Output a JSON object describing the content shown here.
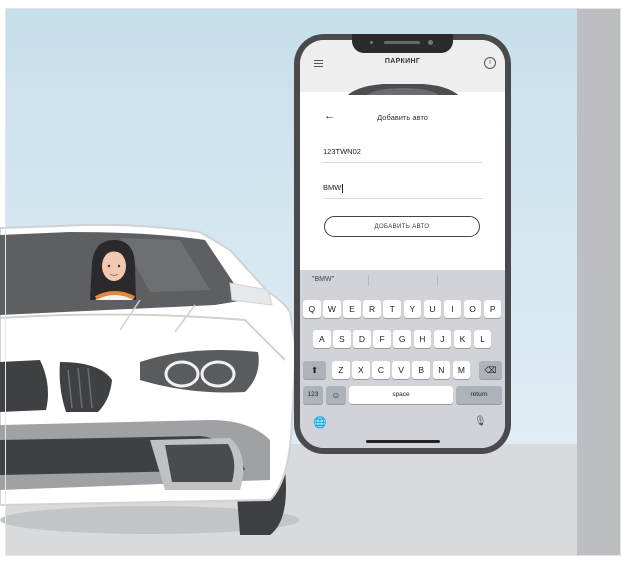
{
  "app": {
    "title": "ПАРКИНГ",
    "menu_icon": "hamburger-menu-icon",
    "info_icon": "info-icon",
    "info_glyph": "i"
  },
  "sheet": {
    "back_glyph": "←",
    "title": "Добавить авто",
    "plate_value": "123TWN02",
    "brand_value": "BMW",
    "add_button_label": "ДОБАВИТЬ АВТО"
  },
  "keyboard": {
    "suggestion": "\"BMW\"",
    "row1": [
      "Q",
      "W",
      "E",
      "R",
      "T",
      "Y",
      "U",
      "I",
      "O",
      "P"
    ],
    "row2": [
      "A",
      "S",
      "D",
      "F",
      "G",
      "H",
      "J",
      "K",
      "L"
    ],
    "row3": [
      "Z",
      "X",
      "C",
      "V",
      "B",
      "N",
      "M"
    ],
    "shift_glyph": "⬆",
    "backspace_glyph": "⌫",
    "numbers_label": "123",
    "emoji_glyph": "☺",
    "space_label": "space",
    "return_label": "return",
    "globe_glyph": "🌐",
    "mic_glyph": "🎙"
  },
  "colors": {
    "phone_body": "#4a4a4c",
    "keyboard_bg": "#d1d3d9",
    "wall": "#c6dfec",
    "floor": "#d9dadc"
  }
}
